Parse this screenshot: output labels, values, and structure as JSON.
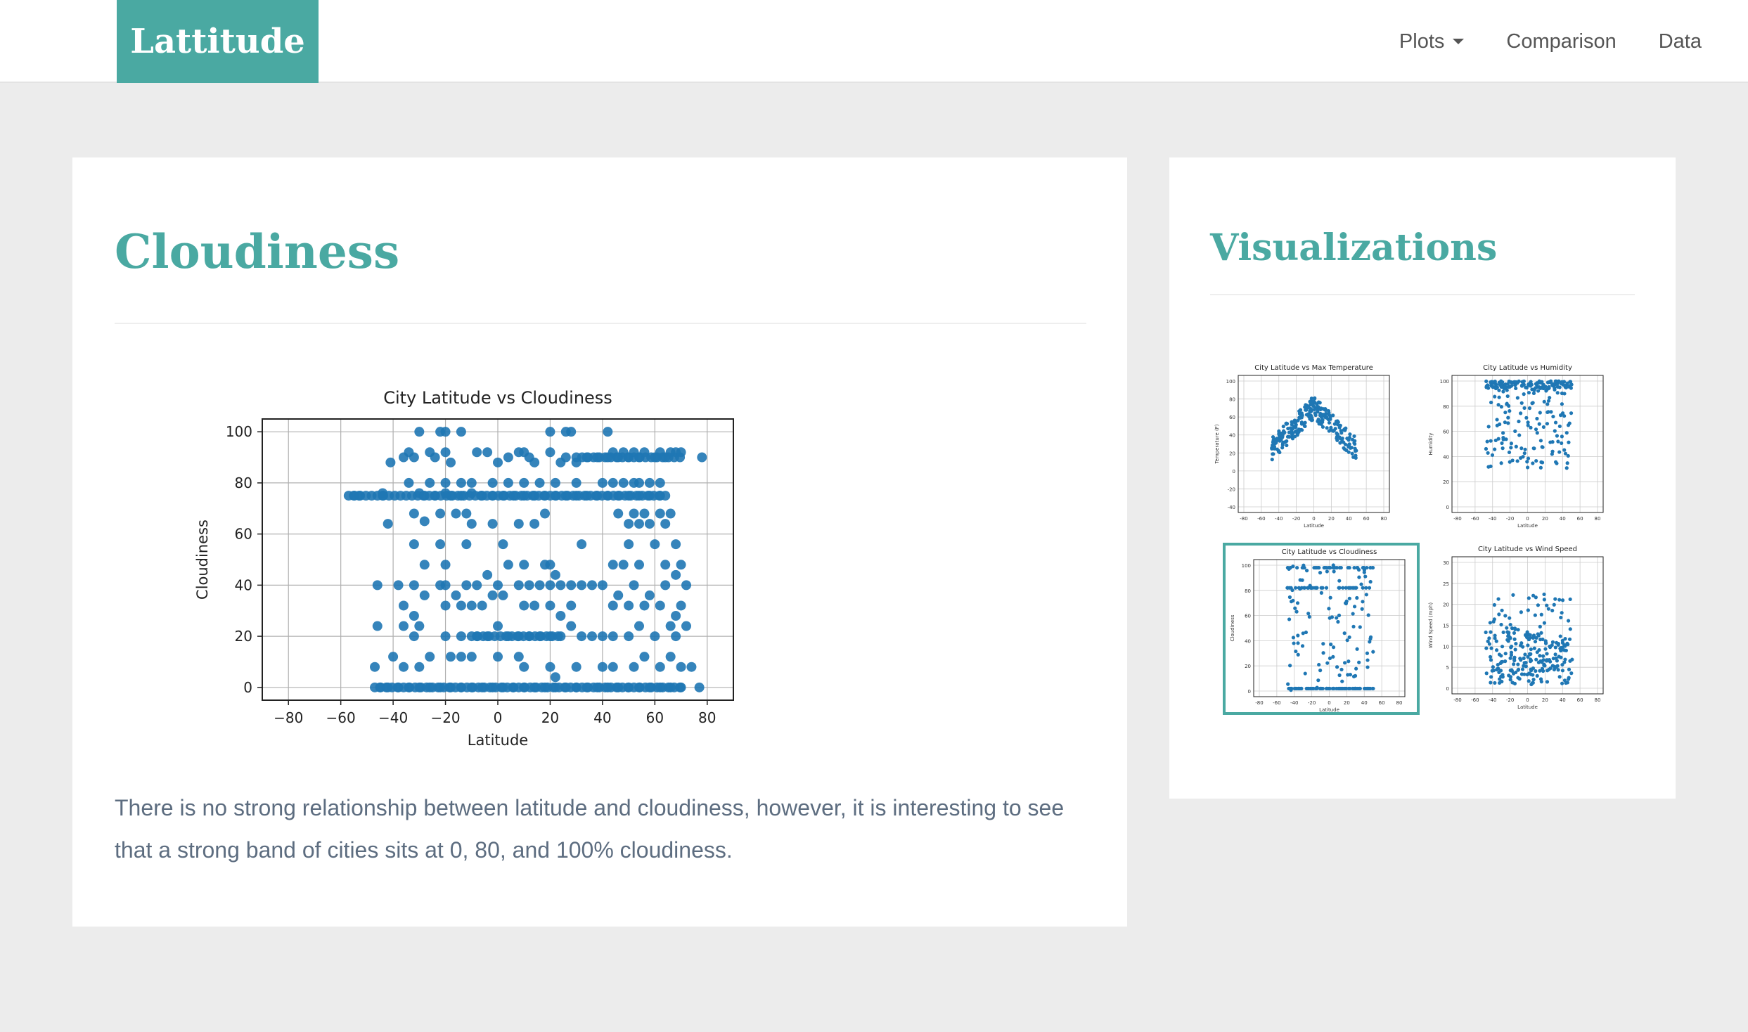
{
  "navbar": {
    "brand": "Lattitude",
    "links": [
      {
        "label": "Plots",
        "has_dropdown": true
      },
      {
        "label": "Comparison"
      },
      {
        "label": "Data"
      }
    ]
  },
  "main": {
    "title": "Cloudiness",
    "description": "There is no strong relationship between latitude and cloudiness, however, it is interesting to see that a strong band of cities sits at 0, 80, and 100% cloudiness."
  },
  "sidebar": {
    "title": "Visualizations",
    "thumbnails": [
      {
        "title": "City Latitude vs Max Temperature",
        "xlabel": "Latitude",
        "ylabel": "Temperature (F)",
        "yticks": [
          "100",
          "80",
          "60",
          "40",
          "20",
          "0",
          "-20",
          "-40"
        ],
        "selected": false
      },
      {
        "title": "City Latitude vs Humidity",
        "xlabel": "Latitude",
        "ylabel": "Humidity",
        "yticks": [
          "100",
          "80",
          "60",
          "40",
          "20",
          "0"
        ],
        "selected": false
      },
      {
        "title": "City Latitude vs Cloudiness",
        "xlabel": "Latitude",
        "ylabel": "Cloudiness",
        "yticks": [
          "100",
          "80",
          "60",
          "40",
          "20",
          "0"
        ],
        "selected": true
      },
      {
        "title": "City Latitude vs Wind Speed",
        "xlabel": "Latitude",
        "ylabel": "Wind Speed (mph)",
        "yticks": [
          "30",
          "25",
          "20",
          "15",
          "10",
          "5",
          "0"
        ],
        "selected": false
      }
    ],
    "xticks": [
      "-80",
      "-60",
      "-40",
      "-20",
      "0",
      "20",
      "40",
      "60",
      "80"
    ]
  },
  "colors": {
    "accent": "#4aa9a2",
    "marker": "#1f77b4",
    "text_muted": "#5d6d80"
  },
  "chart_data": {
    "type": "scatter",
    "title": "City Latitude vs Cloudiness",
    "xlabel": "Latitude",
    "ylabel": "Cloudiness",
    "xlim": [
      -90,
      90
    ],
    "ylim": [
      -5,
      105
    ],
    "xticks": [
      -80,
      -60,
      -40,
      -20,
      0,
      20,
      40,
      60,
      80
    ],
    "yticks": [
      0,
      20,
      40,
      60,
      80,
      100
    ],
    "grid": true,
    "bands": [
      {
        "y": 0,
        "x_from": -47,
        "x_to": 70
      },
      {
        "y": 20,
        "x_from": -10,
        "x_to": 25
      },
      {
        "y": 75,
        "x_from": -57,
        "x_to": 65
      },
      {
        "y": 90,
        "x_from": 30,
        "x_to": 70
      }
    ],
    "points": [
      [
        -55,
        75
      ],
      [
        -53,
        75
      ],
      [
        -44,
        76
      ],
      [
        -44,
        75
      ],
      [
        -42,
        64
      ],
      [
        -41,
        88
      ],
      [
        -36,
        90
      ],
      [
        -34,
        92
      ],
      [
        -32,
        90
      ],
      [
        -30,
        76
      ],
      [
        -28,
        75
      ],
      [
        -24,
        75
      ],
      [
        -20,
        76
      ],
      [
        -18,
        75
      ],
      [
        -14,
        75
      ],
      [
        -10,
        76
      ],
      [
        -6,
        75
      ],
      [
        -2,
        75
      ],
      [
        2,
        75
      ],
      [
        6,
        75
      ],
      [
        10,
        75
      ],
      [
        14,
        75
      ],
      [
        18,
        75
      ],
      [
        22,
        75
      ],
      [
        26,
        75
      ],
      [
        30,
        75
      ],
      [
        34,
        75
      ],
      [
        38,
        75
      ],
      [
        42,
        75
      ],
      [
        46,
        75
      ],
      [
        50,
        75
      ],
      [
        54,
        75
      ],
      [
        58,
        75
      ],
      [
        62,
        75
      ],
      [
        -30,
        100
      ],
      [
        -22,
        100
      ],
      [
        -20,
        100
      ],
      [
        -14,
        100
      ],
      [
        20,
        100
      ],
      [
        26,
        100
      ],
      [
        28,
        100
      ],
      [
        42,
        100
      ],
      [
        -26,
        92
      ],
      [
        -24,
        90
      ],
      [
        -20,
        92
      ],
      [
        -18,
        88
      ],
      [
        -8,
        92
      ],
      [
        -4,
        92
      ],
      [
        0,
        88
      ],
      [
        4,
        90
      ],
      [
        8,
        92
      ],
      [
        10,
        92
      ],
      [
        12,
        90
      ],
      [
        14,
        88
      ],
      [
        20,
        92
      ],
      [
        24,
        88
      ],
      [
        26,
        90
      ],
      [
        30,
        88
      ],
      [
        34,
        90
      ],
      [
        38,
        90
      ],
      [
        42,
        90
      ],
      [
        44,
        92
      ],
      [
        46,
        90
      ],
      [
        48,
        92
      ],
      [
        50,
        90
      ],
      [
        52,
        92
      ],
      [
        54,
        90
      ],
      [
        56,
        92
      ],
      [
        60,
        90
      ],
      [
        62,
        92
      ],
      [
        64,
        90
      ],
      [
        66,
        92
      ],
      [
        68,
        92
      ],
      [
        70,
        92
      ],
      [
        78,
        90
      ],
      [
        -34,
        80
      ],
      [
        -26,
        80
      ],
      [
        -20,
        80
      ],
      [
        -14,
        80
      ],
      [
        -10,
        80
      ],
      [
        -2,
        80
      ],
      [
        4,
        80
      ],
      [
        10,
        80
      ],
      [
        16,
        80
      ],
      [
        22,
        80
      ],
      [
        30,
        80
      ],
      [
        40,
        80
      ],
      [
        44,
        80
      ],
      [
        48,
        80
      ],
      [
        52,
        80
      ],
      [
        54,
        80
      ],
      [
        58,
        80
      ],
      [
        62,
        80
      ],
      [
        -32,
        68
      ],
      [
        -28,
        65
      ],
      [
        -22,
        68
      ],
      [
        -16,
        68
      ],
      [
        -12,
        68
      ],
      [
        -10,
        64
      ],
      [
        -2,
        64
      ],
      [
        8,
        64
      ],
      [
        14,
        64
      ],
      [
        18,
        68
      ],
      [
        32,
        56
      ],
      [
        46,
        68
      ],
      [
        50,
        64
      ],
      [
        52,
        68
      ],
      [
        54,
        64
      ],
      [
        56,
        68
      ],
      [
        58,
        64
      ],
      [
        62,
        68
      ],
      [
        64,
        64
      ],
      [
        66,
        68
      ],
      [
        -32,
        56
      ],
      [
        -28,
        48
      ],
      [
        -22,
        56
      ],
      [
        -12,
        56
      ],
      [
        -20,
        48
      ],
      [
        2,
        56
      ],
      [
        4,
        48
      ],
      [
        10,
        48
      ],
      [
        18,
        48
      ],
      [
        20,
        48
      ],
      [
        22,
        44
      ],
      [
        44,
        48
      ],
      [
        48,
        48
      ],
      [
        50,
        56
      ],
      [
        54,
        48
      ],
      [
        60,
        56
      ],
      [
        64,
        48
      ],
      [
        68,
        56
      ],
      [
        70,
        48
      ],
      [
        -46,
        40
      ],
      [
        -38,
        40
      ],
      [
        -32,
        40
      ],
      [
        -28,
        36
      ],
      [
        -22,
        40
      ],
      [
        -20,
        40
      ],
      [
        -16,
        36
      ],
      [
        -12,
        40
      ],
      [
        -8,
        40
      ],
      [
        -4,
        44
      ],
      [
        0,
        40
      ],
      [
        2,
        36
      ],
      [
        8,
        40
      ],
      [
        12,
        40
      ],
      [
        16,
        40
      ],
      [
        20,
        40
      ],
      [
        24,
        40
      ],
      [
        28,
        40
      ],
      [
        32,
        40
      ],
      [
        36,
        40
      ],
      [
        40,
        40
      ],
      [
        46,
        36
      ],
      [
        52,
        40
      ],
      [
        58,
        36
      ],
      [
        64,
        40
      ],
      [
        68,
        44
      ],
      [
        72,
        40
      ],
      [
        -36,
        32
      ],
      [
        -32,
        28
      ],
      [
        -30,
        24
      ],
      [
        -20,
        32
      ],
      [
        -14,
        32
      ],
      [
        -10,
        32
      ],
      [
        -6,
        32
      ],
      [
        -2,
        36
      ],
      [
        10,
        32
      ],
      [
        14,
        32
      ],
      [
        20,
        32
      ],
      [
        24,
        28
      ],
      [
        28,
        32
      ],
      [
        44,
        32
      ],
      [
        50,
        32
      ],
      [
        56,
        32
      ],
      [
        62,
        32
      ],
      [
        68,
        28
      ],
      [
        70,
        32
      ],
      [
        -46,
        24
      ],
      [
        -36,
        24
      ],
      [
        -32,
        20
      ],
      [
        -20,
        20
      ],
      [
        -14,
        20
      ],
      [
        -8,
        20
      ],
      [
        -4,
        20
      ],
      [
        0,
        24
      ],
      [
        4,
        20
      ],
      [
        8,
        20
      ],
      [
        12,
        20
      ],
      [
        16,
        20
      ],
      [
        20,
        20
      ],
      [
        24,
        20
      ],
      [
        28,
        24
      ],
      [
        32,
        20
      ],
      [
        36,
        20
      ],
      [
        40,
        20
      ],
      [
        44,
        20
      ],
      [
        50,
        20
      ],
      [
        54,
        24
      ],
      [
        60,
        20
      ],
      [
        66,
        24
      ],
      [
        68,
        20
      ],
      [
        72,
        24
      ],
      [
        -40,
        12
      ],
      [
        -36,
        8
      ],
      [
        -30,
        8
      ],
      [
        -26,
        12
      ],
      [
        -18,
        12
      ],
      [
        -14,
        12
      ],
      [
        -10,
        12
      ],
      [
        0,
        12
      ],
      [
        8,
        12
      ],
      [
        10,
        8
      ],
      [
        20,
        8
      ],
      [
        22,
        4
      ],
      [
        30,
        8
      ],
      [
        40,
        8
      ],
      [
        44,
        8
      ],
      [
        52,
        8
      ],
      [
        56,
        12
      ],
      [
        62,
        8
      ],
      [
        66,
        12
      ],
      [
        70,
        8
      ],
      [
        74,
        8
      ],
      [
        -47,
        8
      ],
      [
        -45,
        0
      ],
      [
        -42,
        0
      ],
      [
        -38,
        0
      ],
      [
        -34,
        0
      ],
      [
        -30,
        0
      ],
      [
        -26,
        0
      ],
      [
        -22,
        0
      ],
      [
        -18,
        0
      ],
      [
        -14,
        0
      ],
      [
        -10,
        0
      ],
      [
        -6,
        0
      ],
      [
        -2,
        0
      ],
      [
        2,
        0
      ],
      [
        6,
        0
      ],
      [
        10,
        0
      ],
      [
        14,
        0
      ],
      [
        18,
        0
      ],
      [
        22,
        0
      ],
      [
        26,
        0
      ],
      [
        30,
        0
      ],
      [
        34,
        0
      ],
      [
        38,
        0
      ],
      [
        42,
        0
      ],
      [
        46,
        0
      ],
      [
        50,
        0
      ],
      [
        54,
        0
      ],
      [
        58,
        0
      ],
      [
        62,
        0
      ],
      [
        66,
        0
      ],
      [
        70,
        0
      ],
      [
        77,
        0
      ]
    ]
  }
}
